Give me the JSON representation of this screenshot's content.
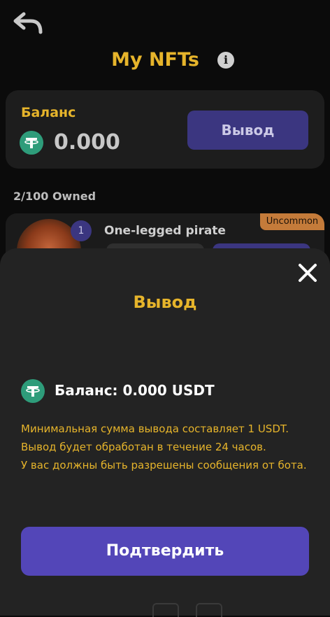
{
  "header": {
    "title": "My NFTs",
    "info_icon": "i"
  },
  "balance_card": {
    "label": "Баланс",
    "value": "0.000",
    "withdraw_label": "Вывод",
    "token_icon": "tether-icon"
  },
  "owned": "2/100 Owned",
  "nft": {
    "number": "1",
    "name": "One-legged pirate",
    "rarity": "Uncommon"
  },
  "sheet": {
    "title": "Вывод",
    "balance": "Баланс: 0.000 USDT",
    "notes": [
      "Минимальная сумма вывода составляет 1 USDT.",
      "Вывод будет обработан в течение 24 часов.",
      "У вас должны быть разрешены сообщения от бота."
    ],
    "confirm_label": "Подтвердить"
  },
  "colors": {
    "accent": "#e6b42b",
    "primary": "#5346b8",
    "tether": "#2e9c7a"
  }
}
